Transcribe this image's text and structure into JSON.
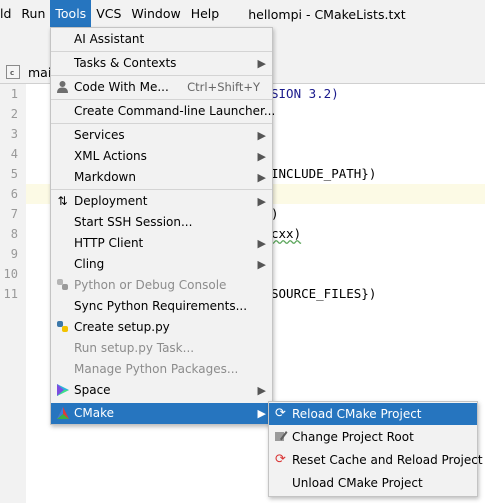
{
  "menubar": {
    "items": [
      {
        "label": "ld"
      },
      {
        "label": "Run"
      },
      {
        "label": "Tools"
      },
      {
        "label": "VCS"
      },
      {
        "label": "Window"
      },
      {
        "label": "Help"
      }
    ],
    "window_title": "hellompi - CMakeLists.txt"
  },
  "tab": {
    "label": "mai",
    "icon_letter": "c"
  },
  "editor": {
    "line_numbers": [
      "1",
      "2",
      "3",
      "4",
      "5",
      "6",
      "7",
      "8",
      "9",
      "10",
      "11"
    ],
    "code": {
      "line1": "SION 3.2)",
      "line5": "INCLUDE_PATH})",
      "line7": ")",
      "line8": "cxx)",
      "line11": "SOURCE_FILES})"
    }
  },
  "tools_menu": {
    "items": [
      {
        "label": "AI Assistant"
      },
      {
        "label": "Tasks & Contexts"
      },
      {
        "label": "Code With Me...",
        "shortcut": "Ctrl+Shift+Y"
      },
      {
        "label": "Create Command-line Launcher..."
      },
      {
        "label": "Services"
      },
      {
        "label": "XML Actions"
      },
      {
        "label": "Markdown"
      },
      {
        "label": "Deployment"
      },
      {
        "label": "Start SSH Session..."
      },
      {
        "label": "HTTP Client"
      },
      {
        "label": "Cling"
      },
      {
        "label": "Python or Debug Console"
      },
      {
        "label": "Sync Python Requirements..."
      },
      {
        "label": "Create setup.py"
      },
      {
        "label": "Run setup.py Task..."
      },
      {
        "label": "Manage Python Packages..."
      },
      {
        "label": "Space"
      },
      {
        "label": "CMake"
      }
    ]
  },
  "cmake_submenu": {
    "items": [
      {
        "label": "Reload CMake Project"
      },
      {
        "label": "Change Project Root"
      },
      {
        "label": "Reset Cache and Reload Project"
      },
      {
        "label": "Unload CMake Project"
      }
    ]
  },
  "colors": {
    "selection": "#2675bf",
    "menu_bg": "#f2f2f2",
    "current_line": "#fcfae5",
    "disabled_text": "#8c8c8c"
  }
}
